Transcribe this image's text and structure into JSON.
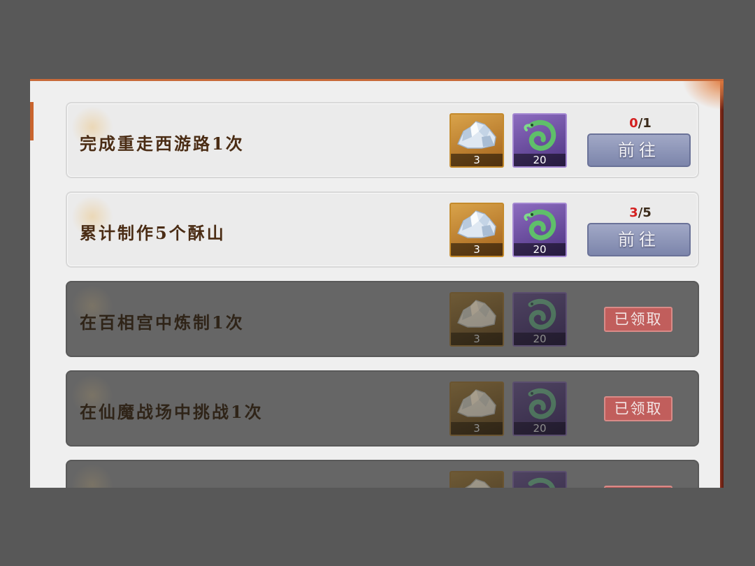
{
  "tasks": [
    {
      "title": "完成重走西游路1次",
      "rewards": [
        "3",
        "20"
      ],
      "progress_current": "0",
      "progress_total": "/1",
      "action": "前往",
      "state": "active"
    },
    {
      "title": "累计制作5个酥山",
      "rewards": [
        "3",
        "20"
      ],
      "progress_current": "3",
      "progress_total": "/5",
      "action": "前往",
      "state": "active"
    },
    {
      "title": "在百相宫中炼制1次",
      "rewards": [
        "3",
        "20"
      ],
      "action": "已领取",
      "state": "claimed"
    },
    {
      "title": "在仙魔战场中挑战1次",
      "rewards": [
        "3",
        "20"
      ],
      "action": "已领取",
      "state": "claimed"
    },
    {
      "title": "",
      "state": "claimed"
    }
  ],
  "icons": {
    "reward_1": "silver-ore-icon",
    "reward_2": "jade-dragon-icon"
  },
  "colors": {
    "progress_current": "#d42020",
    "go_button": "#8f97b9",
    "claimed_badge": "#c15e5c",
    "reward_gold_frame": "#c48a2c",
    "reward_purple_frame": "#6b4fa0"
  }
}
